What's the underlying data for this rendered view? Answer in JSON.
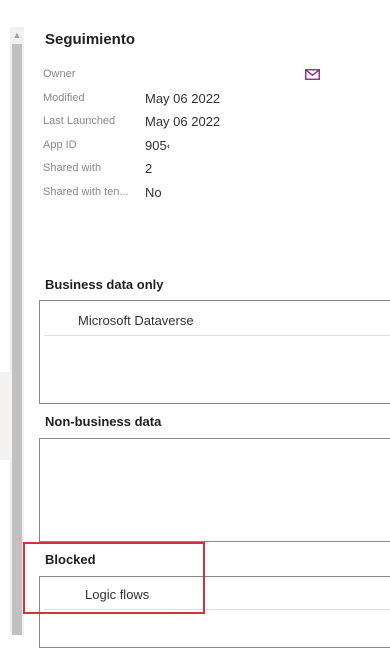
{
  "details": {
    "title": "Seguimiento",
    "owner_label": "Owner",
    "owner_icon": "mail-icon",
    "modified_label": "Modified",
    "modified_value": "May 06 2022",
    "last_launched_label": "Last Launched",
    "last_launched_value": "May 06 2022",
    "app_id_label": "App ID",
    "app_id_value": "905‹",
    "shared_with_label": "Shared with",
    "shared_with_value": "2",
    "shared_with_tenant_label": "Shared with ten...",
    "shared_with_tenant_value": "No"
  },
  "data_policy": {
    "business": {
      "heading": "Business data only",
      "items": [
        "Microsoft Dataverse"
      ]
    },
    "non_business": {
      "heading": "Non-business data",
      "items": []
    },
    "blocked": {
      "heading": "Blocked",
      "items": [
        "Logic flows"
      ]
    }
  },
  "colors": {
    "accent_icon": "#8a2a8a",
    "highlight": "#d13438"
  }
}
